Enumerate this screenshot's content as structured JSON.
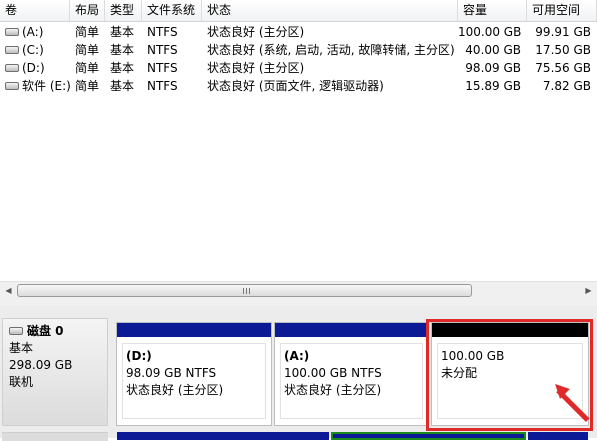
{
  "columns": [
    "卷",
    "布局",
    "类型",
    "文件系统",
    "状态",
    "容量",
    "可用空间"
  ],
  "volumes": [
    {
      "name": "(A:)",
      "layout": "简单",
      "type": "基本",
      "fs": "NTFS",
      "status": "状态良好 (主分区)",
      "capacity": "100.00 GB",
      "free": "99.91 GB"
    },
    {
      "name": "(C:)",
      "layout": "简单",
      "type": "基本",
      "fs": "NTFS",
      "status": "状态良好 (系统, 启动, 活动, 故障转储, 主分区)",
      "capacity": "40.00 GB",
      "free": "17.50 GB"
    },
    {
      "name": "(D:)",
      "layout": "简单",
      "type": "基本",
      "fs": "NTFS",
      "status": "状态良好 (主分区)",
      "capacity": "98.09 GB",
      "free": "75.56 GB"
    },
    {
      "name": "软件 (E:)",
      "layout": "简单",
      "type": "基本",
      "fs": "NTFS",
      "status": "状态良好 (页面文件, 逻辑驱动器)",
      "capacity": "15.89 GB",
      "free": "7.82 GB"
    }
  ],
  "scrollbar": {
    "left_arrow": "◀",
    "right_arrow": "▶"
  },
  "disk0": {
    "title": "磁盘 0",
    "type": "基本",
    "size": "298.09 GB",
    "state": "联机",
    "partitions": [
      {
        "name": "(D:)",
        "size": "98.09 GB NTFS",
        "status": "状态良好 (主分区)"
      },
      {
        "name": "(A:)",
        "size": "100.00 GB NTFS",
        "status": "状态良好 (主分区)"
      },
      {
        "name": "",
        "size": "100.00 GB",
        "status": "未分配"
      }
    ]
  },
  "colors": {
    "primary_partition": "#0c1a96",
    "unallocated": "#000000",
    "highlight": "#e02a2a",
    "selected": "#1d8a1d"
  },
  "icons": {
    "drive": "drive-icon",
    "disk": "disk-icon"
  }
}
